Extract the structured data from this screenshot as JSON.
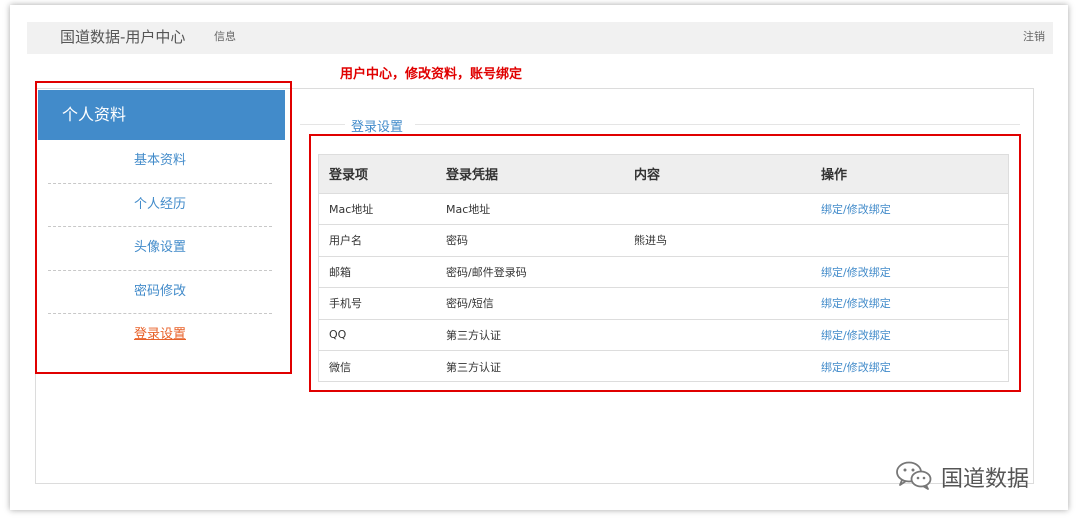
{
  "header": {
    "brand": "国道数据-用户中心",
    "nav_info": "信息",
    "logout": "注销"
  },
  "annotation": "用户中心，修改资料，账号绑定",
  "sidebar": {
    "title": "个人资料",
    "items": [
      {
        "label": "基本资料",
        "active": false
      },
      {
        "label": "个人经历",
        "active": false
      },
      {
        "label": "头像设置",
        "active": false
      },
      {
        "label": "密码修改",
        "active": false
      },
      {
        "label": "登录设置",
        "active": true
      }
    ]
  },
  "main": {
    "section_title": "登录设置",
    "table": {
      "headers": [
        "登录项",
        "登录凭据",
        "内容",
        "操作"
      ],
      "rows": [
        {
          "item": "Mac地址",
          "credential": "Mac地址",
          "content": "",
          "action": "绑定/修改绑定"
        },
        {
          "item": "用户名",
          "credential": "密码",
          "content": "熊进鸟",
          "action": ""
        },
        {
          "item": "邮箱",
          "credential": "密码/邮件登录码",
          "content": "",
          "action": "绑定/修改绑定"
        },
        {
          "item": "手机号",
          "credential": "密码/短信",
          "content": "",
          "action": "绑定/修改绑定"
        },
        {
          "item": "QQ",
          "credential": "第三方认证",
          "content": "",
          "action": "绑定/修改绑定"
        },
        {
          "item": "微信",
          "credential": "第三方认证",
          "content": "",
          "action": "绑定/修改绑定"
        }
      ]
    }
  },
  "watermark": {
    "icon": "wechat-icon",
    "text": "国道数据"
  },
  "colors": {
    "primary": "#428bca",
    "active_link": "#e8622a",
    "highlight": "#e00000"
  }
}
